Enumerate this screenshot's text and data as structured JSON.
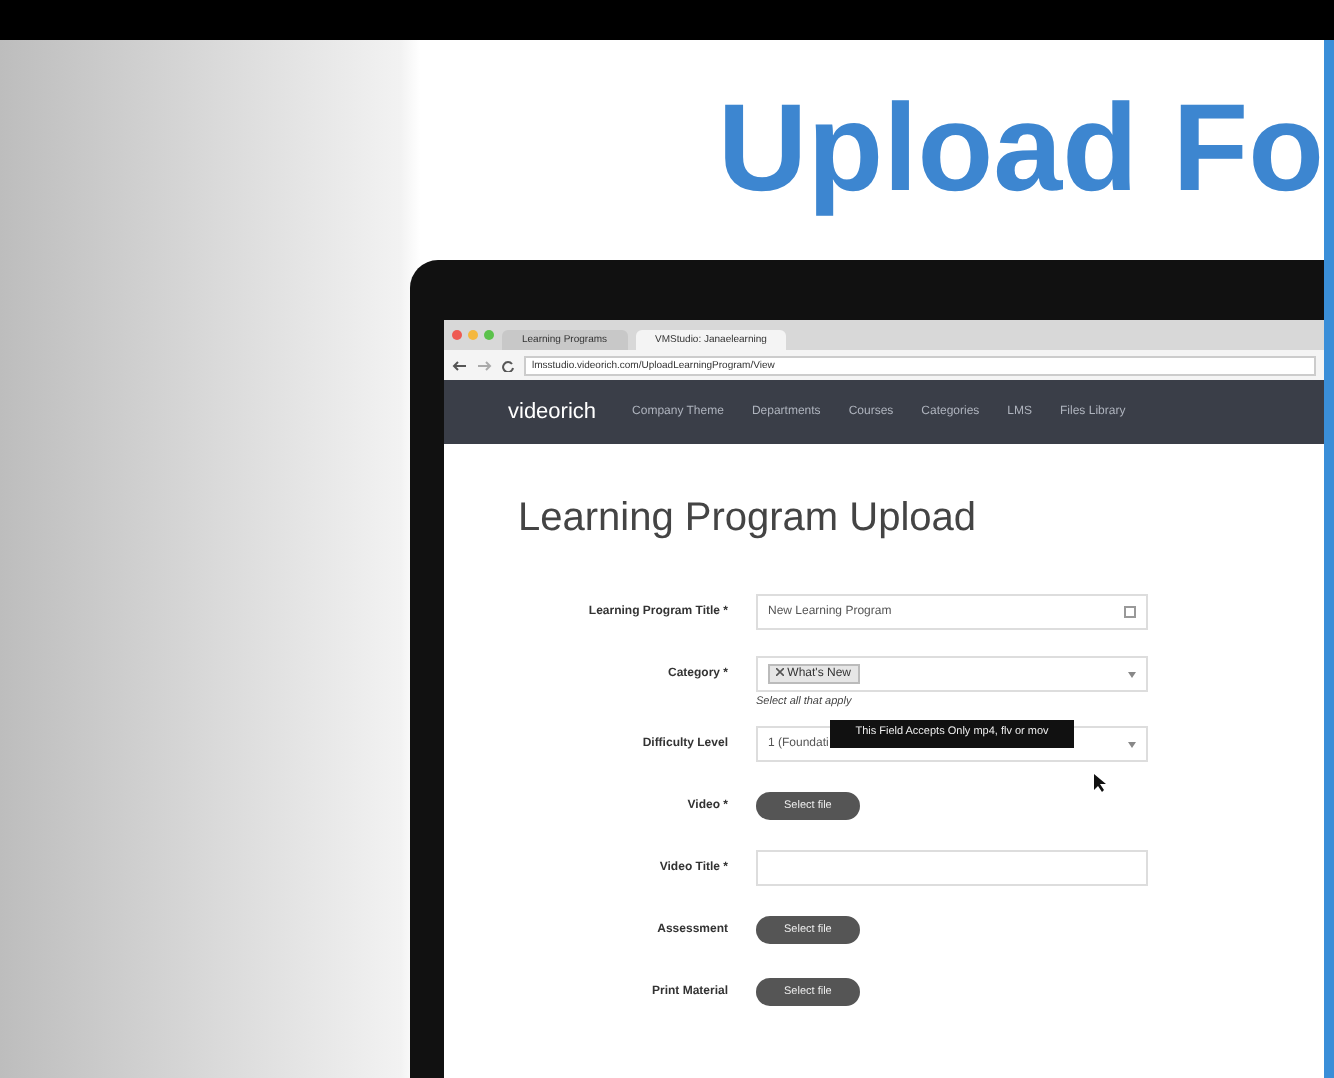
{
  "slide": {
    "title": "Upload Fo"
  },
  "browser": {
    "tabs": [
      {
        "label": "Learning Programs",
        "selected": false
      },
      {
        "label": "VMStudio: Janaelearning",
        "selected": true
      }
    ],
    "url": "lmsstudio.videorich.com/UploadLearningProgram/View"
  },
  "navbar": {
    "brand": "videorich",
    "items": [
      "Company Theme",
      "Departments",
      "Courses",
      "Categories",
      "LMS",
      "Files Library"
    ]
  },
  "page": {
    "heading": "Learning Program Upload"
  },
  "form": [
    {
      "kind": "text",
      "label": "Learning Program Title *",
      "value": "New Learning Program"
    },
    {
      "kind": "tags",
      "label": "Category *",
      "tag": "What's New",
      "hint": "Select all that apply"
    },
    {
      "kind": "select",
      "label": "Difficulty Level",
      "value": "1 (Foundati",
      "tooltip": "This Field Accepts Only mp4, flv or mov"
    },
    {
      "kind": "file",
      "label": "Video *",
      "button": "Select file"
    },
    {
      "kind": "text",
      "label": "Video Title *"
    },
    {
      "kind": "file",
      "label": "Assessment",
      "button": "Select file"
    },
    {
      "kind": "file",
      "label": "Print Material",
      "button": "Select file"
    }
  ]
}
